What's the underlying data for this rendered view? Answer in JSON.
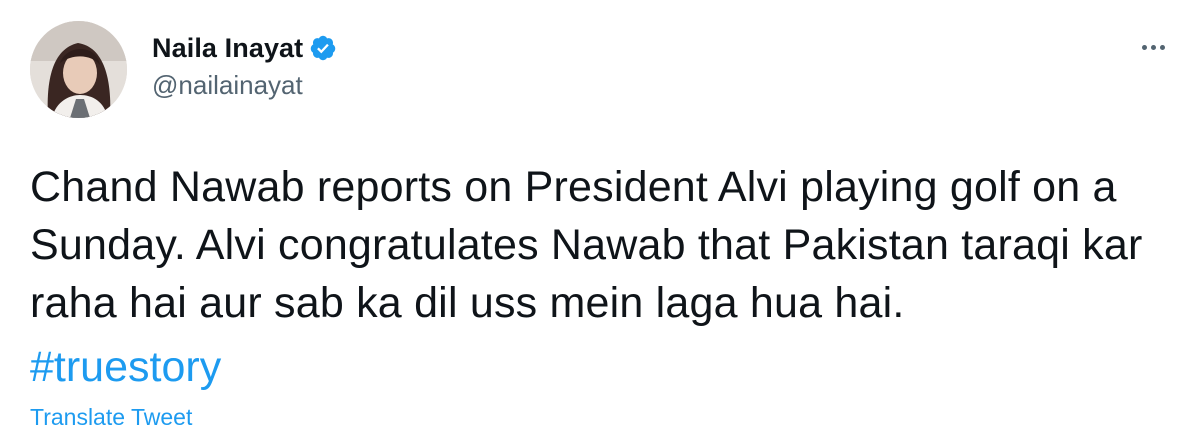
{
  "author": {
    "display_name": "Naila Inayat",
    "handle": "@nailainayat",
    "verified": true
  },
  "tweet": {
    "text": "Chand Nawab reports on President Alvi playing golf on a Sunday. Alvi congratulates Nawab that Pakistan taraqi kar raha hai aur sab ka dil uss mein laga hua hai.",
    "hashtag": "#truestory",
    "translate_label": "Translate Tweet"
  },
  "colors": {
    "accent": "#1d9bf0",
    "text": "#0f1419",
    "secondary_text": "#536471"
  },
  "icons": {
    "verified": "verified-badge-icon",
    "more": "more-options-icon"
  }
}
